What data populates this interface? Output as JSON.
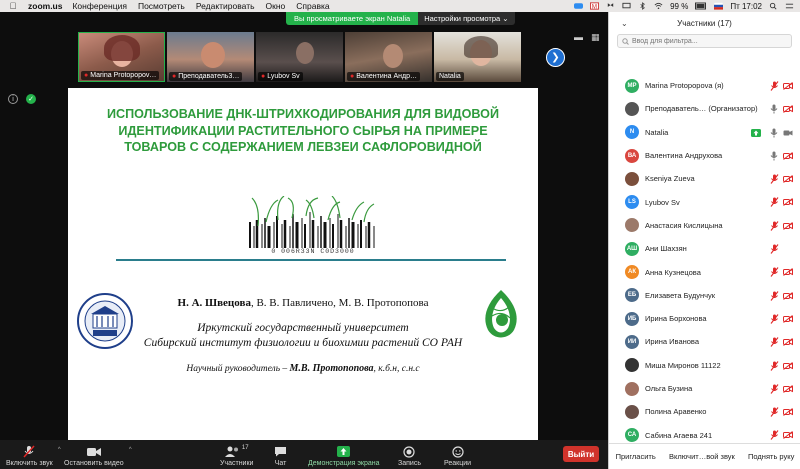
{
  "menubar": {
    "app": "zoom.us",
    "items": [
      "Конференция",
      "Посмотреть",
      "Редактировать",
      "Окно",
      "Справка"
    ],
    "battery": "99 %",
    "datetime": "Пт 17:02"
  },
  "share_banner": {
    "message": "Вы просматриваете экран Natalia",
    "options": "Настройки просмотра"
  },
  "thumbnails": [
    {
      "name": "Marina Protopopov…",
      "muted": true
    },
    {
      "name": "Преподаватель3…",
      "muted": true
    },
    {
      "name": "Lyubov Sv",
      "muted": true
    },
    {
      "name": "Валентина Андр…",
      "muted": true
    },
    {
      "name": "Natalia",
      "muted": false
    }
  ],
  "slide": {
    "title": "ИСПОЛЬЗОВАНИЕ ДНК-ШТРИХКОДИРОВАНИЯ ДЛЯ ВИДОВОЙ ИДЕНТИФИКАЦИИ РАСТИТЕЛЬНОГО СЫРЬЯ НА ПРИМЕРЕ ТОВАРОВ С СОДЕРЖАНИЕМ ЛЕВЗЕИ САФЛОРОВИДНОЙ",
    "barcode_number": "0 006R33N C0D3000",
    "author_main": "Н. А. Швецова",
    "authors_rest": ", В. В. Павличено,  М. В.  Протопопова",
    "affiliation_1": "Иркутский государственный университет",
    "affiliation_2": "Сибирский институт физиологии и биохимии растений СО РАН",
    "supervisor_prefix": "Научный руководитель – ",
    "supervisor_name": "М.В. Протопопова",
    "supervisor_suffix": ", к.б.н, с.н.с"
  },
  "toolbar": {
    "unmute": "Включить звук",
    "stop_video": "Остановить видео",
    "participants": "Участники",
    "participants_count": "17",
    "chat": "Чат",
    "share": "Демонстрация экрана",
    "record": "Запись",
    "reactions": "Реакции",
    "end": "Выйти"
  },
  "panel": {
    "title": "Участники (17)",
    "search_placeholder": "Ввод для фильтра...",
    "participants": [
      {
        "initials": "MP",
        "name": "Marina Protopopova (я)",
        "color": "#2fae62",
        "mic": "muted",
        "cam": "off"
      },
      {
        "initials": "",
        "name": "Преподаватель… (Организатор)",
        "color": "#555555",
        "mic": "on",
        "cam": "off"
      },
      {
        "initials": "N",
        "name": "Natalia",
        "color": "#2d8cf0",
        "mic": "on",
        "cam": "on",
        "sharing": true
      },
      {
        "initials": "ВА",
        "name": "Валентина Андрухова",
        "color": "#d9473f",
        "mic": "on",
        "cam": "off"
      },
      {
        "initials": "",
        "name": "Kseniya Zueva",
        "color": "#7b4f3c",
        "mic": "muted",
        "cam": "off"
      },
      {
        "initials": "LS",
        "name": "Lyubov Sv",
        "color": "#2d8cf0",
        "mic": "muted",
        "cam": "off"
      },
      {
        "initials": "",
        "name": "Анастасия Кислицына",
        "color": "#9c7a6a",
        "mic": "muted",
        "cam": "off"
      },
      {
        "initials": "АШ",
        "name": "Ани Шахзян",
        "color": "#2fae62",
        "mic": "muted",
        "cam": "none"
      },
      {
        "initials": "АК",
        "name": "Анна Кузнецова",
        "color": "#f08a24",
        "mic": "muted",
        "cam": "off"
      },
      {
        "initials": "ЕБ",
        "name": "Елизавета Будунчук",
        "color": "#4d6b8a",
        "mic": "muted",
        "cam": "off"
      },
      {
        "initials": "ИБ",
        "name": "Ирина Борхонова",
        "color": "#4d6b8a",
        "mic": "muted",
        "cam": "off"
      },
      {
        "initials": "ИИ",
        "name": "Ирина Иванова",
        "color": "#4d6b8a",
        "mic": "muted",
        "cam": "off"
      },
      {
        "initials": "",
        "name": "Миша Миронов 11122",
        "color": "#333333",
        "mic": "muted",
        "cam": "off"
      },
      {
        "initials": "",
        "name": "Ольга Бузина",
        "color": "#a07060",
        "mic": "muted",
        "cam": "off"
      },
      {
        "initials": "",
        "name": "Полина Аравенко",
        "color": "#6a5048",
        "mic": "muted",
        "cam": "off"
      },
      {
        "initials": "СА",
        "name": "Сабина Агаева 241",
        "color": "#2fae62",
        "mic": "muted",
        "cam": "off"
      }
    ],
    "footer": {
      "invite": "Пригласить",
      "unmute_all": "Включит…вой звук",
      "raise_hand": "Поднять руку"
    }
  },
  "colors": {
    "accent_green": "#24b24b",
    "mute_red": "#e02828",
    "slide_title_green": "#2e9b3c",
    "end_red": "#d0332b"
  }
}
